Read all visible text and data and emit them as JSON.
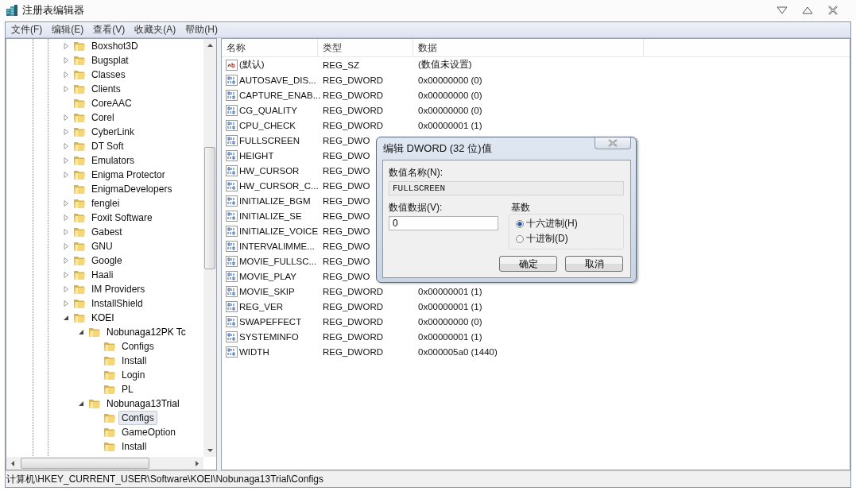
{
  "window": {
    "title": "注册表编辑器"
  },
  "menu": [
    "文件(F)",
    "编辑(E)",
    "查看(V)",
    "收藏夹(A)",
    "帮助(H)"
  ],
  "tree": [
    {
      "label": "Boxshot3D",
      "expanded": false,
      "selected": false
    },
    {
      "label": "Bugsplat",
      "expanded": false,
      "selected": false
    },
    {
      "label": "Classes",
      "expanded": false,
      "selected": false
    },
    {
      "label": "Clients",
      "expanded": false,
      "selected": false
    },
    {
      "label": "CoreAAC",
      "selected": false
    },
    {
      "label": "Corel",
      "expanded": false,
      "selected": false
    },
    {
      "label": "CyberLink",
      "expanded": false,
      "selected": false
    },
    {
      "label": "DT Soft",
      "expanded": false,
      "selected": false
    },
    {
      "label": "Emulators",
      "expanded": false,
      "selected": false
    },
    {
      "label": "Enigma Protector",
      "expanded": false,
      "selected": false
    },
    {
      "label": "EnigmaDevelopers",
      "selected": false
    },
    {
      "label": "fenglei",
      "expanded": false,
      "selected": false
    },
    {
      "label": "Foxit Software",
      "expanded": false,
      "selected": false
    },
    {
      "label": "Gabest",
      "expanded": false,
      "selected": false
    },
    {
      "label": "GNU",
      "expanded": false,
      "selected": false
    },
    {
      "label": "Google",
      "expanded": false,
      "selected": false
    },
    {
      "label": "Haali",
      "expanded": false,
      "selected": false
    },
    {
      "label": "IM Providers",
      "expanded": false,
      "selected": false
    },
    {
      "label": "InstallShield",
      "expanded": false,
      "selected": false
    },
    {
      "label": "KOEI",
      "expanded": true,
      "selected": false,
      "children": [
        {
          "label": "Nobunaga12PK Tc",
          "expanded": true,
          "selected": false,
          "children": [
            {
              "label": "Configs",
              "selected": false
            },
            {
              "label": "Install",
              "selected": false
            },
            {
              "label": "Login",
              "selected": false
            },
            {
              "label": "PL",
              "selected": false
            }
          ]
        },
        {
          "label": "Nobunaga13Trial",
          "expanded": true,
          "selected": false,
          "children": [
            {
              "label": "Configs",
              "selected": true
            },
            {
              "label": "GameOption",
              "selected": false
            },
            {
              "label": "Install",
              "selected": false
            }
          ]
        }
      ]
    }
  ],
  "values": {
    "columns": [
      "名称",
      "类型",
      "数据"
    ],
    "rows": [
      {
        "kind": "string",
        "name": "(默认)",
        "type": "REG_SZ",
        "data": "(数值未设置)"
      },
      {
        "kind": "dword",
        "name": "AUTOSAVE_DIS...",
        "type": "REG_DWORD",
        "data": "0x00000000 (0)"
      },
      {
        "kind": "dword",
        "name": "CAPTURE_ENAB...",
        "type": "REG_DWORD",
        "data": "0x00000000 (0)"
      },
      {
        "kind": "dword",
        "name": "CG_QUALITY",
        "type": "REG_DWORD",
        "data": "0x00000000 (0)"
      },
      {
        "kind": "dword",
        "name": "CPU_CHECK",
        "type": "REG_DWORD",
        "data": "0x00000001 (1)"
      },
      {
        "kind": "dword",
        "name": "FULLSCREEN",
        "type": "REG_DWO"
      },
      {
        "kind": "dword",
        "name": "HEIGHT",
        "type": "REG_DWO"
      },
      {
        "kind": "dword",
        "name": "HW_CURSOR",
        "type": "REG_DWO"
      },
      {
        "kind": "dword",
        "name": "HW_CURSOR_C...",
        "type": "REG_DWO"
      },
      {
        "kind": "dword",
        "name": "INITIALIZE_BGM",
        "type": "REG_DWO"
      },
      {
        "kind": "dword",
        "name": "INITIALIZE_SE",
        "type": "REG_DWO"
      },
      {
        "kind": "dword",
        "name": "INITIALIZE_VOICE",
        "type": "REG_DWO"
      },
      {
        "kind": "dword",
        "name": "INTERVALIMME...",
        "type": "REG_DWO"
      },
      {
        "kind": "dword",
        "name": "MOVIE_FULLSC...",
        "type": "REG_DWO"
      },
      {
        "kind": "dword",
        "name": "MOVIE_PLAY",
        "type": "REG_DWO"
      },
      {
        "kind": "dword",
        "name": "MOVIE_SKIP",
        "type": "REG_DWORD",
        "data": "0x00000001 (1)"
      },
      {
        "kind": "dword",
        "name": "REG_VER",
        "type": "REG_DWORD",
        "data": "0x00000001 (1)"
      },
      {
        "kind": "dword",
        "name": "SWAPEFFECT",
        "type": "REG_DWORD",
        "data": "0x00000000 (0)"
      },
      {
        "kind": "dword",
        "name": "SYSTEMINFO",
        "type": "REG_DWORD",
        "data": "0x00000001 (1)"
      },
      {
        "kind": "dword",
        "name": "WIDTH",
        "type": "REG_DWORD",
        "data": "0x000005a0 (1440)"
      }
    ]
  },
  "dialog": {
    "title": "编辑 DWORD (32 位)值",
    "name_label": "数值名称(N):",
    "name_value": "FULLSCREEN",
    "data_label": "数值数据(V):",
    "data_value": "0",
    "base_label": "基数",
    "bases": [
      {
        "label": "十六进制(H)",
        "selected": true
      },
      {
        "label": "十进制(D)",
        "selected": false
      }
    ],
    "buttons": [
      "确定",
      "取消"
    ]
  },
  "status_bar": {
    "path": "计算机\\HKEY_CURRENT_USER\\Software\\KOEI\\Nobunaga13Trial\\Configs"
  }
}
